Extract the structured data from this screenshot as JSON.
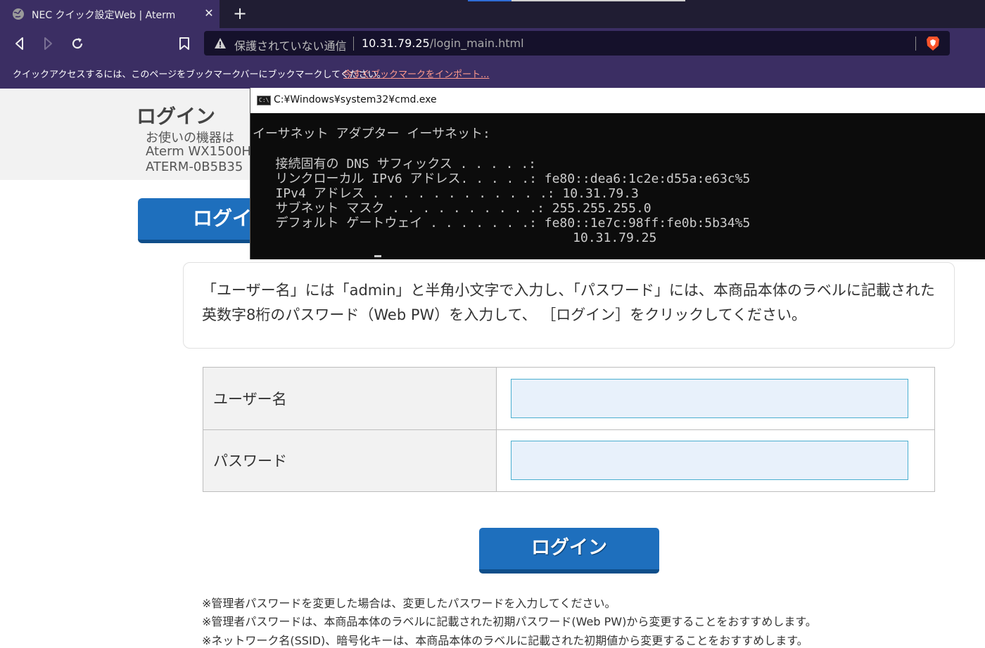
{
  "browser": {
    "tab_title": "NEC クイック設定Web | Aterm",
    "tab_close": "✕",
    "new_tab": "+",
    "security_label": "保護されていない通信",
    "url_host": "10.31.79.25",
    "url_path": "/login_main.html",
    "bookmark_message": "クイックアクセスするには、このページをブックマークバーにブックマークしてください。",
    "bookmark_link": "今すぐブックマークをインポート..."
  },
  "page": {
    "title": "ログイン",
    "device_lines": [
      "お使いの機器は",
      "Aterm WX1500H",
      "ATERM-0B5B35"
    ],
    "top_login_button": "ログイン",
    "instruction": "「ユーザー名」には「admin」と半角小文字で入力し、「パスワード」には、本商品本体のラベルに記載された英数字8桁のパスワード（Web PW）を入力して、 ［ログイン］をクリックしてください。",
    "form": {
      "username_label": "ユーザー名",
      "username_value": "",
      "password_label": "パスワード",
      "password_value": ""
    },
    "login_button": "ログイン",
    "notes": [
      "※管理者パスワードを変更した場合は、変更したパスワードを入力してください。",
      "※管理者パスワードは、本商品本体のラベルに記載された初期パスワード(Web PW)から変更することをおすすめします。",
      "※ネットワーク名(SSID)、暗号化キーは、本商品本体のラベルに記載された初期値から変更することをおすすめします。"
    ]
  },
  "cmd": {
    "window_title": "C:¥Windows¥system32¥cmd.exe",
    "icon_text": "C:\\",
    "lines": [
      "イーサネット アダプター イーサネット:",
      "",
      "   接続固有の DNS サフィックス . . . . .:",
      "   リンクローカル IPv6 アドレス. . . . .: fe80::dea6:1c2e:d55a:e63c%5",
      "   IPv4 アドレス . . . . . . . . . . . .: 10.31.79.3",
      "   サブネット マスク . . . . . . . . . .: 255.255.255.0",
      "   デフォルト ゲートウェイ . . . . . . .: fe80::1e7c:98ff:fe0b:5b34%5",
      "                                          10.31.79.25"
    ]
  },
  "colors": {
    "browser_chrome": "#3b2e63",
    "tabstrip": "#201d33",
    "button_blue": "#1e6fbd",
    "input_border": "#4aaed0",
    "input_fill": "#e8f1fb",
    "bookmark_link": "#ff9a8c"
  }
}
